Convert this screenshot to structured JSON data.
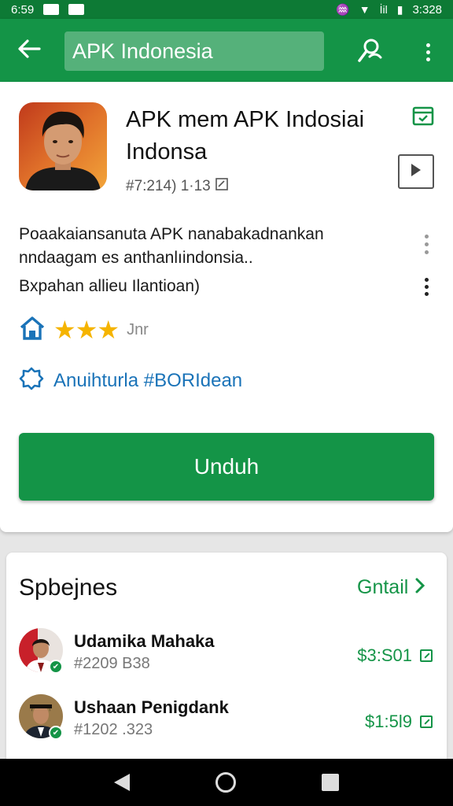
{
  "status_bar": {
    "time": "6:59",
    "right_time": "3:328",
    "signal": "İil"
  },
  "app_bar": {
    "back_icon": "arrow-left-icon",
    "search_text": "APK Indonesia",
    "action_icon": "search-person-icon",
    "menu_icon": "more-vert-icon"
  },
  "app": {
    "title_line1": "APK mem APK Indosiai",
    "title_line2": "Indonsa",
    "meta": "#7:214) 1·13",
    "description_line1": "Poaakaiansanuta APK nanabakadnankan",
    "description_line2": "nndaagam es anthanlıindonsia..",
    "description_line3": "Bxpahan allieu Ilantioan)",
    "stars": "★★★",
    "rating_count": "Jnr",
    "tag": "Anuihturla #BORIdean",
    "download_label": "Unduh"
  },
  "section": {
    "title": "Spbejnes",
    "link_label": "Gntail",
    "items": [
      {
        "name": "Udamika Mahaka",
        "id": "#2209 B38",
        "price": "$3:S01"
      },
      {
        "name": "Ushaan Penigdank",
        "id": "#1202 .323",
        "price": "$1:5l9"
      }
    ]
  },
  "colors": {
    "primary": "#149447",
    "primary_dark": "#0d7a35",
    "link_blue": "#1a73b8",
    "star": "#f5b400"
  }
}
